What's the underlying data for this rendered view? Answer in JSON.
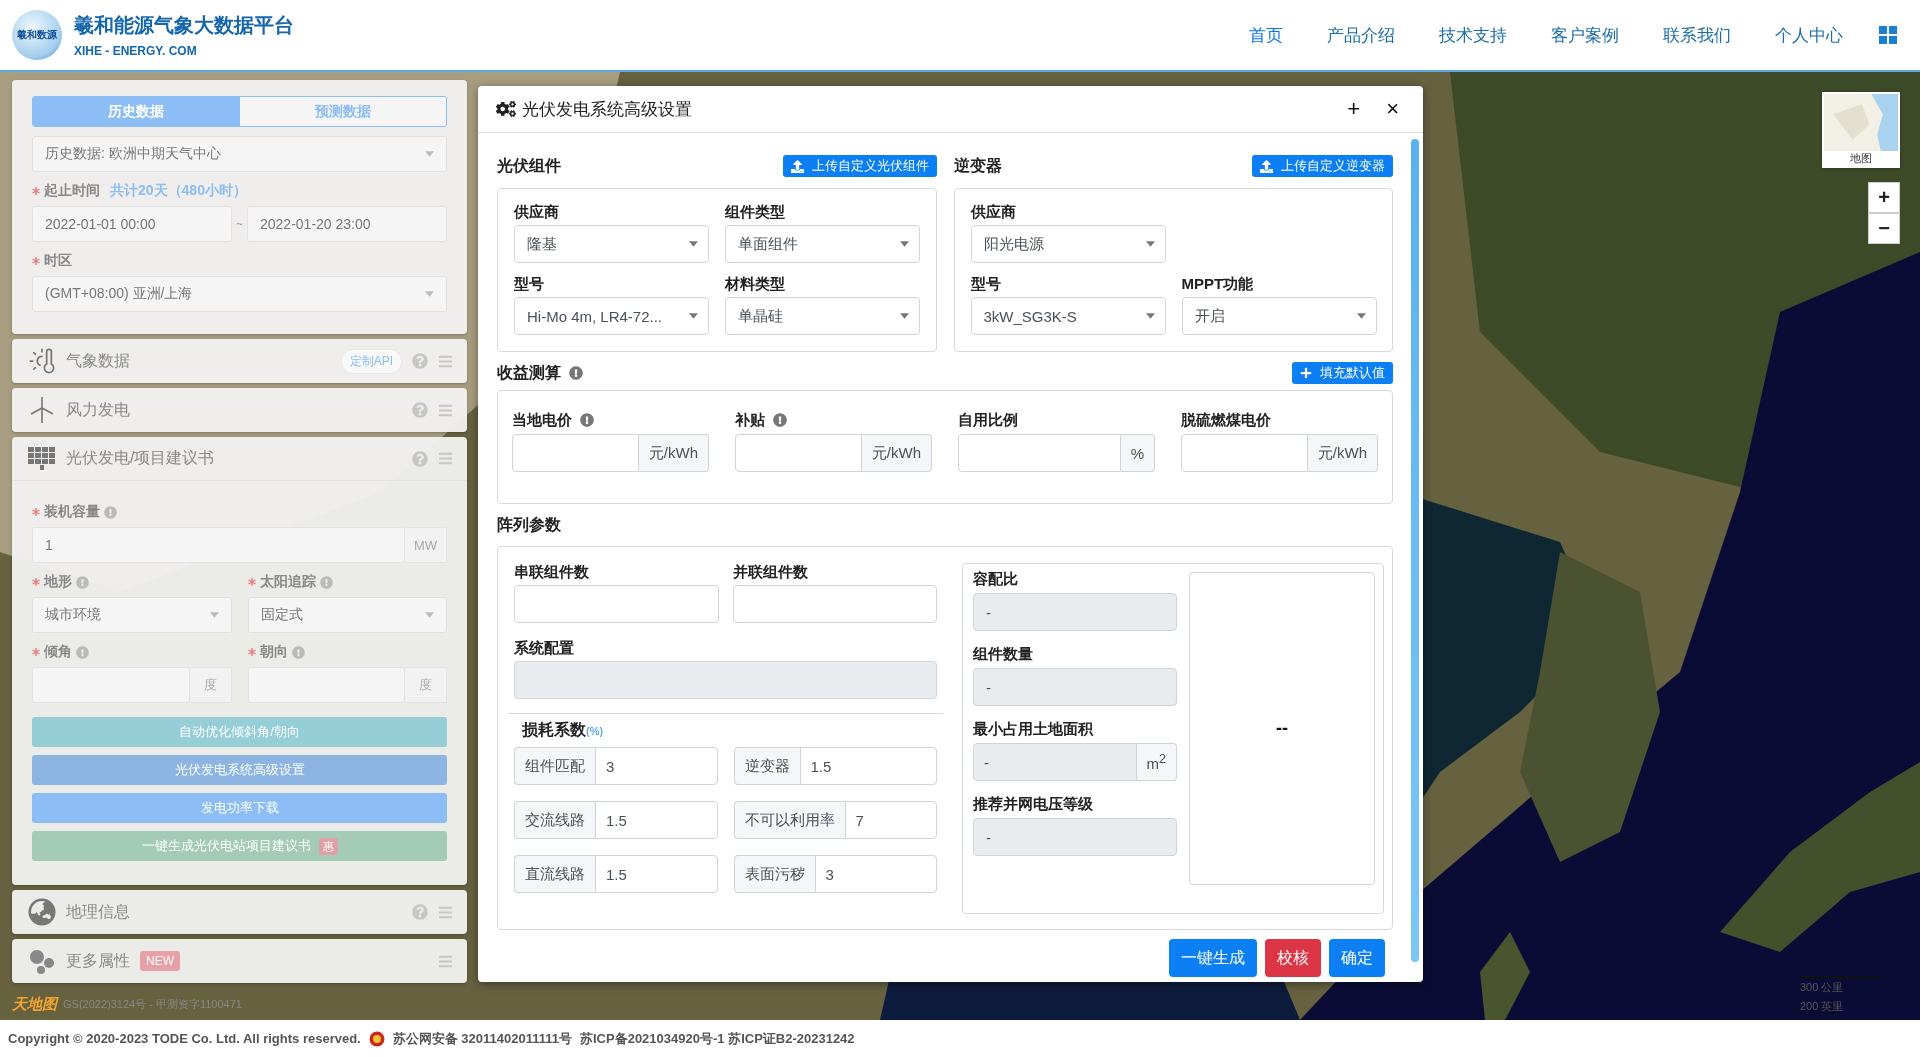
{
  "header": {
    "logo_text": "羲和数源",
    "title": "羲和能源气象大数据平台",
    "subtitle": "XIHE - ENERGY. COM",
    "nav": [
      {
        "label": "首页",
        "selected": true
      },
      {
        "label": "产品介绍",
        "selected": false
      },
      {
        "label": "技术支持",
        "selected": false
      },
      {
        "label": "客户案例",
        "selected": false
      },
      {
        "label": "联系我们",
        "selected": false
      },
      {
        "label": "个人中心",
        "selected": false
      }
    ]
  },
  "left_panel": {
    "data_tabs": [
      {
        "label": "历史数据",
        "selected": true
      },
      {
        "label": "预测数据",
        "selected": false
      }
    ],
    "source": {
      "value": "历史数据: 欧洲中期天气中心"
    },
    "period": {
      "label": "起止时间",
      "required": true,
      "note": "共计20天（480小时）",
      "start": "2022-01-01 00:00",
      "separator": "~",
      "end": "2022-01-20 23:00"
    },
    "timezone": {
      "label": "时区",
      "required": true,
      "value": "(GMT+08:00) 亚洲/上海"
    },
    "sections": [
      {
        "kind": "weather",
        "title": "气象数据",
        "badge": {
          "text": "定制API",
          "kind": "pill"
        },
        "help": true
      },
      {
        "kind": "wind",
        "title": "风力发电",
        "help": true
      }
    ],
    "pv": {
      "kind": "solar",
      "title": "光伏发电/项目建议书",
      "help": true,
      "capacity": {
        "label": "装机容量",
        "required": true,
        "info": true,
        "value": "1",
        "unit": "MW"
      },
      "fields": [
        {
          "kind": "select",
          "label": "地形",
          "required": true,
          "info": true,
          "value": "城市环境"
        },
        {
          "kind": "select",
          "label": "太阳追踪",
          "required": true,
          "info": true,
          "value": "固定式"
        },
        {
          "kind": "unit",
          "label": "倾角",
          "required": true,
          "info": true,
          "unit": "度"
        },
        {
          "kind": "unit",
          "label": "朝向",
          "required": true,
          "info": true,
          "unit": "度"
        }
      ],
      "buttons": [
        {
          "label": "自动优化倾斜角/朝向",
          "color": "#96ced7"
        },
        {
          "label": "光伏发电系统高级设置",
          "color": "#8db5e3"
        },
        {
          "label": "发电功率下载",
          "color": "#8cbdf4"
        },
        {
          "label": "一键生成光伏电站项目建议书",
          "color": "#a4cbb7",
          "badge": "惠"
        }
      ]
    },
    "bottom_sections": [
      {
        "kind": "globe",
        "title": "地理信息",
        "help": true
      },
      {
        "kind": "dots",
        "title": "更多属性",
        "badge": {
          "text": "NEW",
          "kind": "tag"
        },
        "help": false
      }
    ]
  },
  "dialog": {
    "title": "光伏发电系统高级设置",
    "maximize": "+",
    "close": "×",
    "module": {
      "title": "光伏组件",
      "upload": "上传自定义光伏组件",
      "fields": [
        {
          "label": "供应商",
          "value": "隆基"
        },
        {
          "label": "组件类型",
          "value": "单面组件"
        },
        {
          "label": "型号",
          "value": "Hi-Mo 4m, LR4-72..."
        },
        {
          "label": "材料类型",
          "value": "单晶硅"
        }
      ]
    },
    "inverter": {
      "title": "逆变器",
      "upload": "上传自定义逆变器",
      "fields": [
        {
          "label": "供应商",
          "value": "阳光电源"
        },
        {
          "label": "型号",
          "value": "3kW_SG3K-S"
        },
        {
          "label": "MPPT功能",
          "value": "开启"
        }
      ]
    },
    "revenue": {
      "title": "收益测算",
      "info": true,
      "fill_button": "填充默认值",
      "fields": [
        {
          "label": "当地电价",
          "info": true,
          "unit": "元/kWh"
        },
        {
          "label": "补贴",
          "info": true,
          "unit": "元/kWh"
        },
        {
          "label": "自用比例",
          "info": false,
          "unit": "%"
        },
        {
          "label": "脱硫燃煤电价",
          "info": false,
          "unit": "元/kWh"
        }
      ]
    },
    "array": {
      "title": "阵列参数",
      "inputs": [
        {
          "label": "串联组件数"
        },
        {
          "label": "并联组件数"
        }
      ],
      "system_config": {
        "label": "系统配置"
      },
      "loss": {
        "title": "损耗系数",
        "note": "(%)",
        "items": [
          {
            "label": "组件匹配",
            "value": "3"
          },
          {
            "label": "逆变器",
            "value": "1.5"
          },
          {
            "label": "交流线路",
            "value": "1.5"
          },
          {
            "label": "不可以利用率",
            "value": "7"
          },
          {
            "label": "直流线路",
            "value": "1.5"
          },
          {
            "label": "表面污秽",
            "value": "3"
          }
        ]
      },
      "results": [
        {
          "label": "容配比",
          "value": "-"
        },
        {
          "label": "组件数量",
          "value": "-"
        },
        {
          "label": "最小占用土地面积",
          "value": "-",
          "unit": "m$^{2}$"
        },
        {
          "label": "推荐并网电压等级",
          "value": "-"
        }
      ],
      "preview": "--"
    },
    "actions": [
      {
        "label": "一键生成",
        "kind": "primary"
      },
      {
        "label": "校核",
        "kind": "danger"
      },
      {
        "label": "确定",
        "kind": "primary"
      }
    ]
  },
  "map": {
    "minimap_label": "地图",
    "zoom_in": "+",
    "zoom_out": "−",
    "scale": [
      "300 公里",
      "200 英里"
    ],
    "attribution_logo": "天地图",
    "attribution": "GS(2022)3124号 - 甲测资字1100471"
  },
  "footer": {
    "copyright": "Copyright © 2020-2023 TODE Co. Ltd. All rights reserved.",
    "police": "苏公网安备 32011402011111号",
    "icp": "苏ICP备2021034920号-1 苏ICP证B2-20231242"
  }
}
